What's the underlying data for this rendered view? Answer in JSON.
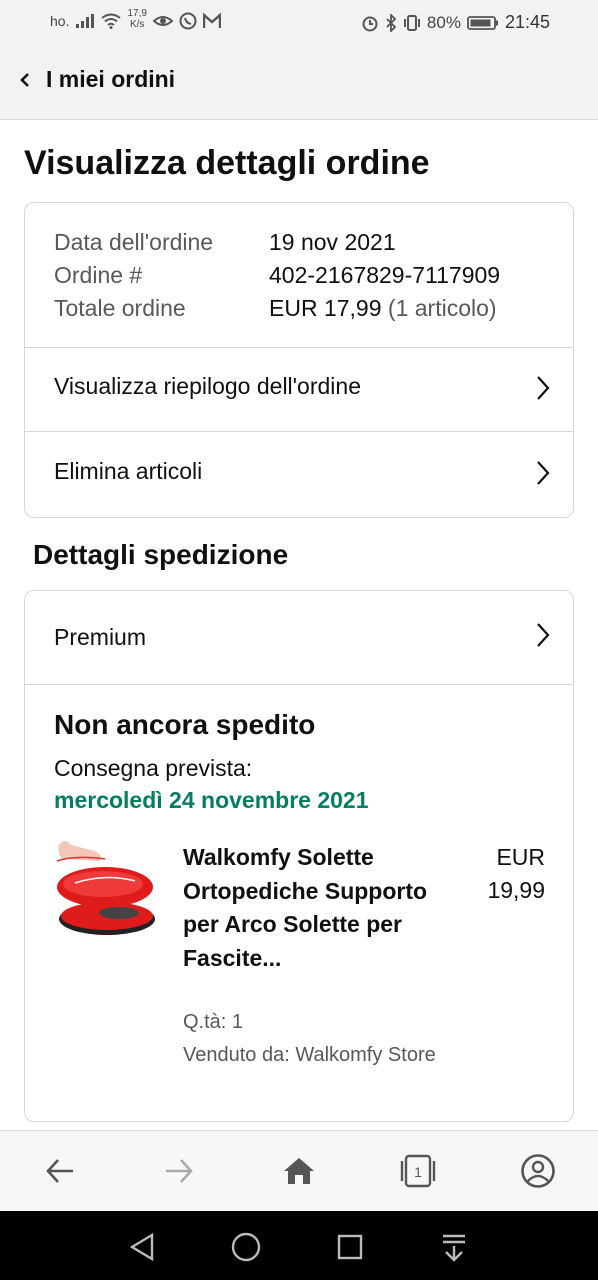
{
  "status_bar": {
    "carrier": "ho.",
    "speed_value": "17,9",
    "speed_unit": "K/s",
    "battery_percent": "80%",
    "time": "21:45",
    "icons": [
      "signal-icon",
      "wifi-icon",
      "eye-icon",
      "whatsapp-icon",
      "gmail-icon",
      "alarm-icon",
      "bluetooth-icon",
      "vibrate-icon",
      "battery-icon"
    ]
  },
  "nav": {
    "back_label": "I miei ordini"
  },
  "page_title": "Visualizza dettagli ordine",
  "order_summary": {
    "date_label": "Data dell'ordine",
    "date_value": "19 nov 2021",
    "order_label": "Ordine #",
    "order_value": "402-2167829-7117909",
    "total_label": "Totale ordine",
    "total_value": "EUR 17,99",
    "total_items": "(1 articolo)"
  },
  "order_actions": {
    "view_summary": "Visualizza riepilogo dell'ordine",
    "delete_items": "Elimina articoli"
  },
  "shipping": {
    "section_title": "Dettagli spedizione",
    "method": "Premium",
    "status": "Non ancora spedito",
    "delivery_label": "Consegna prevista:",
    "delivery_date": "mercoledì 24 novembre 2021",
    "status_color": "#067d62",
    "product": {
      "title": "Walkomfy Solette Ortopediche Supporto per Arco Solette per Fascite...",
      "price_currency": "EUR",
      "price_value": "19,99",
      "quantity": "Q.tà: 1",
      "seller": "Venduto da: Walkomfy Store"
    }
  },
  "browser_toolbar": {
    "icons": [
      "back-arrow-icon",
      "forward-arrow-icon",
      "home-icon",
      "tabs-icon",
      "account-icon"
    ],
    "tab_count": "1"
  },
  "android_nav": {
    "icons": [
      "nav-back-icon",
      "nav-home-icon",
      "nav-recents-icon",
      "nav-notifications-icon"
    ]
  }
}
